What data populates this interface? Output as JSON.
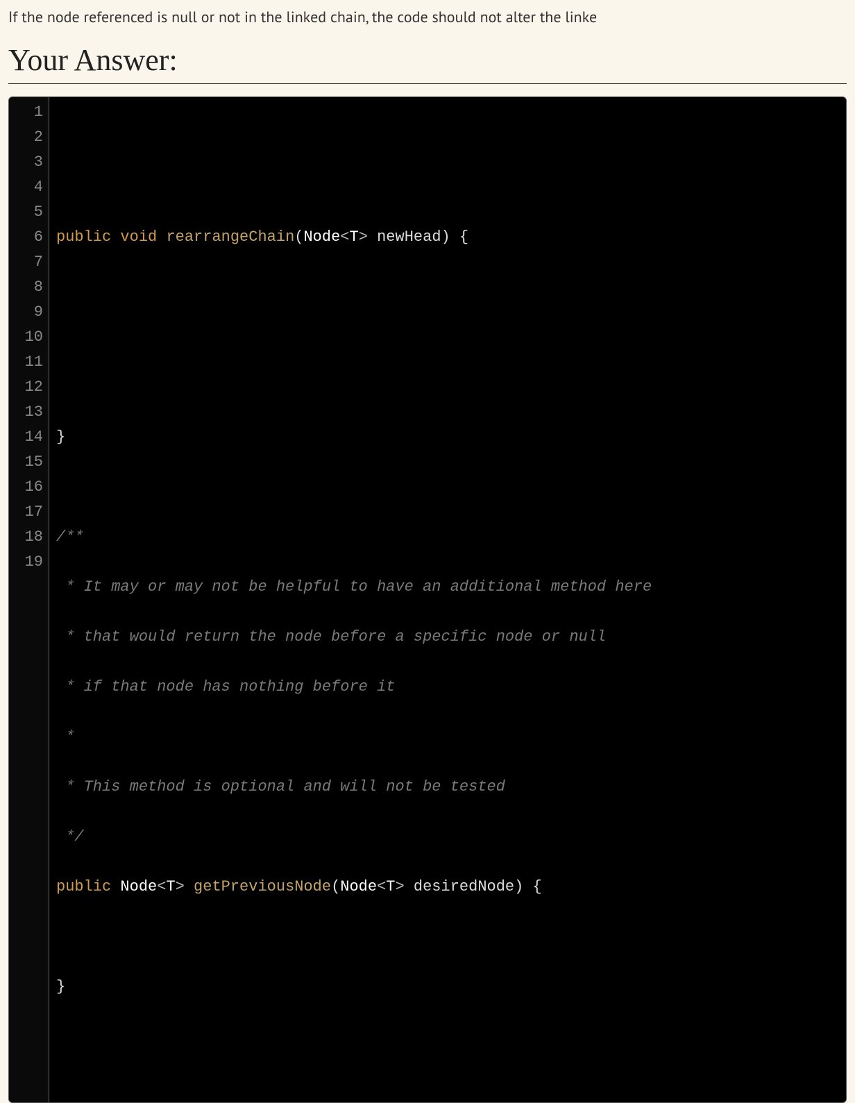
{
  "instruction": "If the node referenced is null or not in the linked chain, the code should not alter the linke",
  "heading": "Your Answer:",
  "editor": {
    "lineCount": 19,
    "lines": {
      "l1": "",
      "l2": "",
      "l3": {
        "kw_public": "public",
        "kw_void": "void",
        "fn": "rearrangeChain",
        "open_paren": "(",
        "type": "Node",
        "lt": "<",
        "generic": "T",
        "gt": ">",
        "param": " newHead",
        "close_paren": ")",
        "brace": " {"
      },
      "l4": "",
      "l5": "",
      "l6": "",
      "l7": "}",
      "l8": "",
      "l9": "/**",
      "l10": " * It may or may not be helpful to have an additional method here",
      "l11": " * that would return the node before a specific node or null",
      "l12": " * if that node has nothing before it",
      "l13": " *",
      "l14": " * This method is optional and will not be tested",
      "l15": " */",
      "l16": {
        "kw_public": "public",
        "ret_type": "Node",
        "ret_lt": "<",
        "ret_generic": "T",
        "ret_gt": ">",
        "fn": " getPreviousNode",
        "open_paren": "(",
        "type": "Node",
        "lt": "<",
        "generic": "T",
        "gt": ">",
        "param": " desiredNode",
        "close_paren": ")",
        "brace": " {"
      },
      "l17": "",
      "l18": "}",
      "l19": ""
    }
  }
}
